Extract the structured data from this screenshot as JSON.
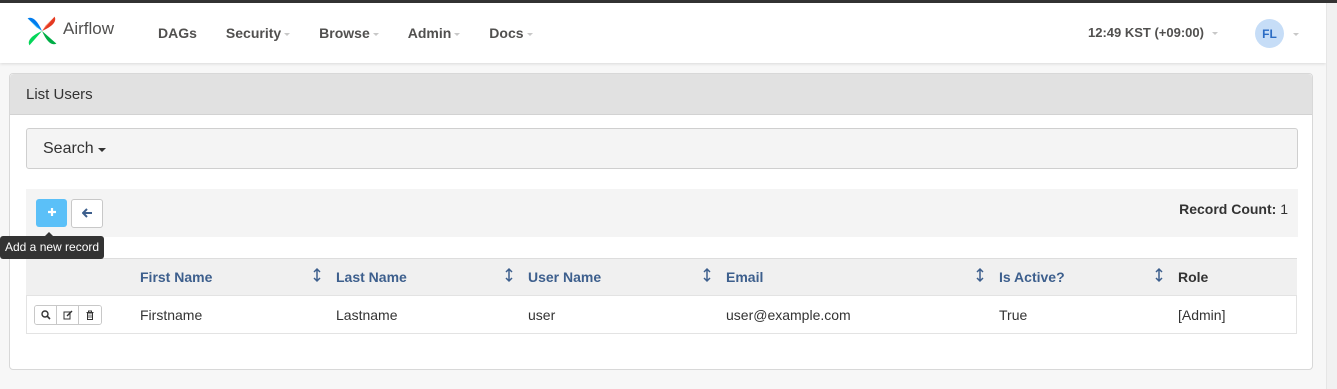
{
  "brand": {
    "name": "Airflow"
  },
  "nav": {
    "items": [
      {
        "label": "DAGs",
        "dropdown": false
      },
      {
        "label": "Security",
        "dropdown": true
      },
      {
        "label": "Browse",
        "dropdown": true
      },
      {
        "label": "Admin",
        "dropdown": true
      },
      {
        "label": "Docs",
        "dropdown": true
      }
    ],
    "clock": "12:49 KST (+09:00)",
    "user_initials": "FL"
  },
  "panel": {
    "title": "List Users",
    "search_label": "Search",
    "add_tooltip": "Add a new record",
    "record_count_label": "Record Count:",
    "record_count_value": "1"
  },
  "table": {
    "columns": [
      "First Name",
      "Last Name",
      "User Name",
      "Email",
      "Is Active?",
      "Role"
    ],
    "rows": [
      {
        "first_name": "Firstname",
        "last_name": "Lastname",
        "user_name": "user",
        "email": "user@example.com",
        "is_active": "True",
        "role": "[Admin]"
      }
    ]
  },
  "colors": {
    "accent_button": "#5bc0f8",
    "header_link": "#3d5f8d",
    "avatar_bg": "#c6ddf7",
    "avatar_text": "#2b6cc4"
  }
}
